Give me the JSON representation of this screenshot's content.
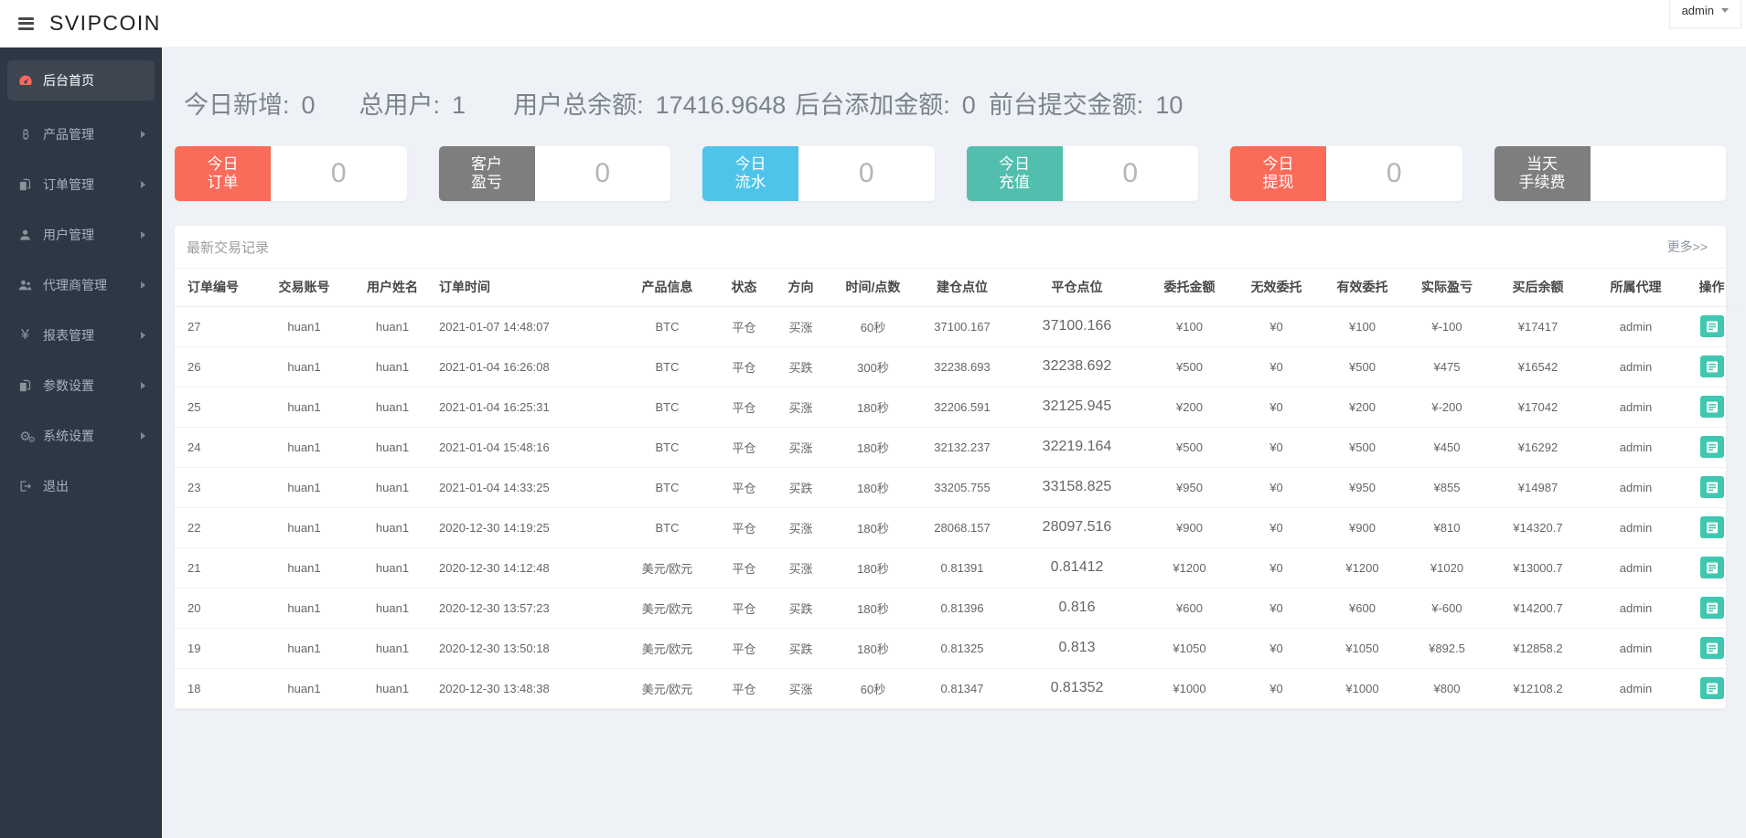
{
  "theme": {
    "red": "#e8262d",
    "green": "#2ea44a",
    "salmon": "#fa6b59",
    "teal_button": "#3fc7b2",
    "sidebar_bg": "#2e3744",
    "page_bg": "#eef1f6"
  },
  "header": {
    "brand": "SVIPCOIN",
    "user": "admin"
  },
  "sidebar": {
    "items": [
      {
        "label": "后台首页",
        "icon": "dashboard-icon",
        "active": true,
        "arrow": false
      },
      {
        "label": "产品管理",
        "icon": "bitcoin-icon",
        "active": false,
        "arrow": true
      },
      {
        "label": "订单管理",
        "icon": "orders-icon",
        "active": false,
        "arrow": true
      },
      {
        "label": "用户管理",
        "icon": "user-icon",
        "active": false,
        "arrow": true
      },
      {
        "label": "代理商管理",
        "icon": "agents-icon",
        "active": false,
        "arrow": true
      },
      {
        "label": "报表管理",
        "icon": "yen-icon",
        "active": false,
        "arrow": true
      },
      {
        "label": "参数设置",
        "icon": "params-icon",
        "active": false,
        "arrow": true
      },
      {
        "label": "系统设置",
        "icon": "gears-icon",
        "active": false,
        "arrow": true
      },
      {
        "label": "退出",
        "icon": "logout-icon",
        "active": false,
        "arrow": false
      }
    ]
  },
  "stats": [
    {
      "label": "今日新增:",
      "value": "0"
    },
    {
      "label": "总用户:",
      "value": "1"
    },
    {
      "label": "用户总余额:",
      "value": "17416.9648"
    },
    {
      "label": "后台添加金额:",
      "value": "0"
    },
    {
      "label": "前台提交金额:",
      "value": "10"
    }
  ],
  "summary_boxes": [
    {
      "line1": "今日",
      "line2": "订单",
      "value": "0",
      "color": "#fa6b59"
    },
    {
      "line1": "客户",
      "line2": "盈亏",
      "value": "0",
      "color": "#7e7e7e"
    },
    {
      "line1": "今日",
      "line2": "流水",
      "value": "0",
      "color": "#4fc4ea"
    },
    {
      "line1": "今日",
      "line2": "充值",
      "value": "0",
      "color": "#52bfae"
    },
    {
      "line1": "今日",
      "line2": "提现",
      "value": "0",
      "color": "#fa6b59"
    },
    {
      "line1": "当天",
      "line2": "手续费",
      "value": "",
      "color": "#7e7e7e"
    }
  ],
  "panel": {
    "title": "最新交易记录",
    "more": "更多>>",
    "columns": [
      "订单编号",
      "交易账号",
      "用户姓名",
      "订单时间",
      "产品信息",
      "状态",
      "方向",
      "时间/点数",
      "建仓点位",
      "平仓点位",
      "委托金额",
      "无效委托",
      "有效委托",
      "实际盈亏",
      "买后余额",
      "所属代理",
      "操作"
    ],
    "rows": [
      {
        "id": "27",
        "account": "huan1",
        "name": "huan1",
        "time": "2021-01-07 14:48:07",
        "product": "BTC",
        "status": "平仓",
        "direction": "买涨",
        "direction_color": "red",
        "duration": "60秒",
        "open": "37100.167",
        "close": "37100.166",
        "close_color": "green",
        "amount": "¥100",
        "invalid": "¥0",
        "valid": "¥100",
        "profit": "¥-100",
        "profit_color": "green",
        "balance": "¥17417",
        "agent": "admin"
      },
      {
        "id": "26",
        "account": "huan1",
        "name": "huan1",
        "time": "2021-01-04 16:26:08",
        "product": "BTC",
        "status": "平仓",
        "direction": "买跌",
        "direction_color": "green",
        "duration": "300秒",
        "open": "32238.693",
        "close": "32238.692",
        "close_color": "green",
        "amount": "¥500",
        "invalid": "¥0",
        "valid": "¥500",
        "profit": "¥475",
        "profit_color": "red",
        "balance": "¥16542",
        "agent": "admin"
      },
      {
        "id": "25",
        "account": "huan1",
        "name": "huan1",
        "time": "2021-01-04 16:25:31",
        "product": "BTC",
        "status": "平仓",
        "direction": "买涨",
        "direction_color": "red",
        "duration": "180秒",
        "open": "32206.591",
        "close": "32125.945",
        "close_color": "green",
        "amount": "¥200",
        "invalid": "¥0",
        "valid": "¥200",
        "profit": "¥-200",
        "profit_color": "green",
        "balance": "¥17042",
        "agent": "admin"
      },
      {
        "id": "24",
        "account": "huan1",
        "name": "huan1",
        "time": "2021-01-04 15:48:16",
        "product": "BTC",
        "status": "平仓",
        "direction": "买涨",
        "direction_color": "red",
        "duration": "180秒",
        "open": "32132.237",
        "close": "32219.164",
        "close_color": "red",
        "amount": "¥500",
        "invalid": "¥0",
        "valid": "¥500",
        "profit": "¥450",
        "profit_color": "red",
        "balance": "¥16292",
        "agent": "admin"
      },
      {
        "id": "23",
        "account": "huan1",
        "name": "huan1",
        "time": "2021-01-04 14:33:25",
        "product": "BTC",
        "status": "平仓",
        "direction": "买跌",
        "direction_color": "green",
        "duration": "180秒",
        "open": "33205.755",
        "close": "33158.825",
        "close_color": "green",
        "amount": "¥950",
        "invalid": "¥0",
        "valid": "¥950",
        "profit": "¥855",
        "profit_color": "red",
        "balance": "¥14987",
        "agent": "admin"
      },
      {
        "id": "22",
        "account": "huan1",
        "name": "huan1",
        "time": "2020-12-30 14:19:25",
        "product": "BTC",
        "status": "平仓",
        "direction": "买涨",
        "direction_color": "red",
        "duration": "180秒",
        "open": "28068.157",
        "close": "28097.516",
        "close_color": "red",
        "amount": "¥900",
        "invalid": "¥0",
        "valid": "¥900",
        "profit": "¥810",
        "profit_color": "red",
        "balance": "¥14320.7",
        "agent": "admin"
      },
      {
        "id": "21",
        "account": "huan1",
        "name": "huan1",
        "time": "2020-12-30 14:12:48",
        "product": "美元/欧元",
        "status": "平仓",
        "direction": "买涨",
        "direction_color": "red",
        "duration": "180秒",
        "open": "0.81391",
        "close": "0.81412",
        "close_color": "red",
        "amount": "¥1200",
        "invalid": "¥0",
        "valid": "¥1200",
        "profit": "¥1020",
        "profit_color": "red",
        "balance": "¥13000.7",
        "agent": "admin"
      },
      {
        "id": "20",
        "account": "huan1",
        "name": "huan1",
        "time": "2020-12-30 13:57:23",
        "product": "美元/欧元",
        "status": "平仓",
        "direction": "买跌",
        "direction_color": "green",
        "duration": "180秒",
        "open": "0.81396",
        "close": "0.816",
        "close_color": "red",
        "amount": "¥600",
        "invalid": "¥0",
        "valid": "¥600",
        "profit": "¥-600",
        "profit_color": "green",
        "balance": "¥14200.7",
        "agent": "admin"
      },
      {
        "id": "19",
        "account": "huan1",
        "name": "huan1",
        "time": "2020-12-30 13:50:18",
        "product": "美元/欧元",
        "status": "平仓",
        "direction": "买跌",
        "direction_color": "green",
        "duration": "180秒",
        "open": "0.81325",
        "close": "0.813",
        "close_color": "green",
        "amount": "¥1050",
        "invalid": "¥0",
        "valid": "¥1050",
        "profit": "¥892.5",
        "profit_color": "red",
        "balance": "¥12858.2",
        "agent": "admin"
      },
      {
        "id": "18",
        "account": "huan1",
        "name": "huan1",
        "time": "2020-12-30 13:48:38",
        "product": "美元/欧元",
        "status": "平仓",
        "direction": "买涨",
        "direction_color": "red",
        "duration": "60秒",
        "open": "0.81347",
        "close": "0.81352",
        "close_color": "red",
        "amount": "¥1000",
        "invalid": "¥0",
        "valid": "¥1000",
        "profit": "¥800",
        "profit_color": "red",
        "balance": "¥12108.2",
        "agent": "admin"
      }
    ]
  }
}
